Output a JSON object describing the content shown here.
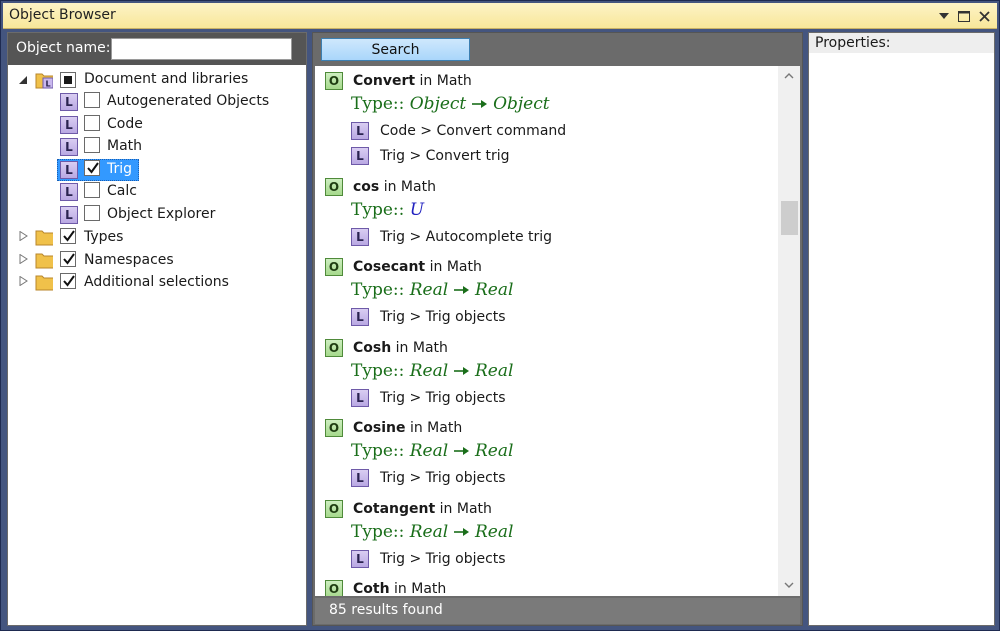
{
  "window": {
    "title": "Object Browser",
    "controls": [
      "dropdown-icon",
      "maximize-icon",
      "close-icon"
    ]
  },
  "left": {
    "object_name_label": "Object name:",
    "object_name_value": "",
    "tree": [
      {
        "label": "Document and libraries",
        "kind": "folder",
        "expanded": true,
        "check": "mixed"
      },
      {
        "label": "Autogenerated Objects",
        "kind": "library",
        "check": "unchecked"
      },
      {
        "label": "Code",
        "kind": "library",
        "check": "unchecked"
      },
      {
        "label": "Math",
        "kind": "library",
        "check": "unchecked"
      },
      {
        "label": "Trig",
        "kind": "library",
        "check": "checked",
        "selected": true
      },
      {
        "label": "Calc",
        "kind": "library",
        "check": "unchecked"
      },
      {
        "label": "Object Explorer",
        "kind": "library",
        "check": "unchecked"
      },
      {
        "label": "Types",
        "kind": "folder",
        "expanded": false,
        "check": "checked"
      },
      {
        "label": "Namespaces",
        "kind": "folder",
        "expanded": false,
        "check": "checked"
      },
      {
        "label": "Additional selections",
        "kind": "folder",
        "expanded": false,
        "check": "checked"
      }
    ],
    "icon_letter": "L"
  },
  "middle": {
    "search_label": "Search",
    "status": "85 results found",
    "object_icon_letter": "O",
    "in_word": "in",
    "type_prefix": "Type::",
    "results": [
      {
        "name": "Convert",
        "scope": "Math",
        "type_from": "Object",
        "type_to": "Object",
        "libs": [
          "Code > Convert command",
          "Trig > Convert trig"
        ]
      },
      {
        "name": "cos",
        "scope": "Math",
        "type_single": "U",
        "libs": [
          "Trig > Autocomplete trig"
        ]
      },
      {
        "name": "Cosecant",
        "scope": "Math",
        "type_from": "Real",
        "type_to": "Real",
        "libs": [
          "Trig > Trig objects"
        ]
      },
      {
        "name": "Cosh",
        "scope": "Math",
        "type_from": "Real",
        "type_to": "Real",
        "libs": [
          "Trig > Trig objects"
        ]
      },
      {
        "name": "Cosine",
        "scope": "Math",
        "type_from": "Real",
        "type_to": "Real",
        "libs": [
          "Trig > Trig objects"
        ]
      },
      {
        "name": "Cotangent",
        "scope": "Math",
        "type_from": "Real",
        "type_to": "Real",
        "libs": [
          "Trig > Trig objects"
        ]
      },
      {
        "name": "Coth",
        "scope": "Math"
      }
    ]
  },
  "right": {
    "properties_label": "Properties:"
  },
  "colors": {
    "titlebar": "#f8e79a",
    "selection": "#3399ff",
    "type_text": "#1a6e1a",
    "type_variable": "#2323c0"
  }
}
